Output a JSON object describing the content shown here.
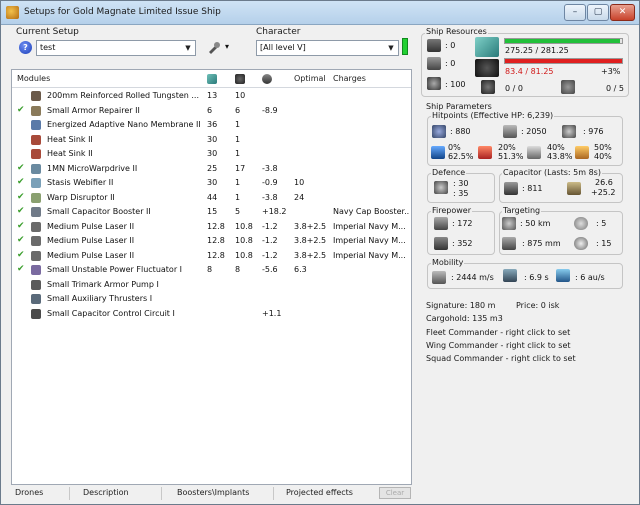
{
  "window": {
    "title": "Setups for Gold Magnate Limited Issue Ship",
    "minimize": "–",
    "maximize": "▢",
    "close": "✕"
  },
  "setup": {
    "label": "Current Setup",
    "value": "test",
    "help": "?",
    "tools_arrow": "▾"
  },
  "character": {
    "label": "Character",
    "value": "[All level V]"
  },
  "modules": {
    "headers": {
      "name": "Modules",
      "optimal": "Optimal",
      "charges": "Charges"
    },
    "rows": [
      {
        "checked": false,
        "name": "200mm Reinforced Rolled Tungsten ...",
        "cpu": "13",
        "pg": "10",
        "cap": "",
        "optimal": "",
        "charges": "",
        "icon": "#6b5a4a"
      },
      {
        "checked": true,
        "name": "Small Armor Repairer II",
        "cpu": "6",
        "pg": "6",
        "cap": "-8.9",
        "optimal": "",
        "charges": "",
        "icon": "#8a7a5a"
      },
      {
        "checked": false,
        "name": "Energized Adaptive Nano Membrane II",
        "cpu": "36",
        "pg": "1",
        "cap": "",
        "optimal": "",
        "charges": "",
        "icon": "#5a7aa8"
      },
      {
        "checked": false,
        "name": "Heat Sink II",
        "cpu": "30",
        "pg": "1",
        "cap": "",
        "optimal": "",
        "charges": "",
        "icon": "#a84a3a"
      },
      {
        "checked": false,
        "name": "Heat Sink II",
        "cpu": "30",
        "pg": "1",
        "cap": "",
        "optimal": "",
        "charges": "",
        "icon": "#a84a3a"
      },
      {
        "checked": true,
        "name": "1MN MicroWarpdrive II",
        "cpu": "25",
        "pg": "17",
        "cap": "-3.8",
        "optimal": "",
        "charges": "",
        "icon": "#6a8aa0"
      },
      {
        "checked": true,
        "name": "Stasis Webifier II",
        "cpu": "30",
        "pg": "1",
        "cap": "-0.9",
        "optimal": "10",
        "charges": "",
        "icon": "#7aa0b8"
      },
      {
        "checked": true,
        "name": "Warp Disruptor II",
        "cpu": "44",
        "pg": "1",
        "cap": "-3.8",
        "optimal": "24",
        "charges": "",
        "icon": "#8aa070"
      },
      {
        "checked": true,
        "name": "Small Capacitor Booster II",
        "cpu": "15",
        "pg": "5",
        "cap": "+18.2",
        "optimal": "",
        "charges": "Navy Cap Booster...",
        "icon": "#707a88"
      },
      {
        "checked": true,
        "name": "Medium Pulse Laser II",
        "cpu": "12.8",
        "pg": "10.8",
        "cap": "-1.2",
        "optimal": "3.8+2.5",
        "charges": "Imperial Navy M...",
        "icon": "#6a6a6a"
      },
      {
        "checked": true,
        "name": "Medium Pulse Laser II",
        "cpu": "12.8",
        "pg": "10.8",
        "cap": "-1.2",
        "optimal": "3.8+2.5",
        "charges": "Imperial Navy M...",
        "icon": "#6a6a6a"
      },
      {
        "checked": true,
        "name": "Medium Pulse Laser II",
        "cpu": "12.8",
        "pg": "10.8",
        "cap": "-1.2",
        "optimal": "3.8+2.5",
        "charges": "Imperial Navy M...",
        "icon": "#6a6a6a"
      },
      {
        "checked": true,
        "name": "Small Unstable Power Fluctuator I",
        "cpu": "8",
        "pg": "8",
        "cap": "-5.6",
        "optimal": "6.3",
        "charges": "",
        "icon": "#7a6aa0"
      },
      {
        "checked": false,
        "name": "Small Trimark Armor Pump I",
        "cpu": "",
        "pg": "",
        "cap": "",
        "optimal": "",
        "charges": "",
        "icon": "#5a5a5a"
      },
      {
        "checked": false,
        "name": "Small Auxiliary Thrusters I",
        "cpu": "",
        "pg": "",
        "cap": "",
        "optimal": "",
        "charges": "",
        "icon": "#5a6a7a"
      },
      {
        "checked": false,
        "name": "Small Capacitor Control Circuit I",
        "cpu": "",
        "pg": "",
        "cap": "+1.1",
        "optimal": "",
        "charges": "",
        "icon": "#4a4a4a"
      }
    ]
  },
  "tabs": {
    "drones": "Drones",
    "description": "Description",
    "boosters": "Boosters\\Implants",
    "projected": "Projected effects",
    "clear": "Clear"
  },
  "resources": {
    "title": "Ship Resources",
    "turrets": ": 0",
    "launchers": ": 0",
    "calibration": ": 100",
    "cpu_text": "275.25 / 281.25",
    "cpu_fraction": 0.979,
    "pg_text": "83.4 / 81.25",
    "pg_delta": "+3%",
    "pg_fraction": 1.0,
    "drone_bw": "0 / 0",
    "drone_slots": "0 / 5",
    "bar_green": "#22c03a",
    "bar_red": "#e02020"
  },
  "params": {
    "title": "Ship Parameters",
    "hitpoints_title": "Hitpoints (Effective HP: 6,239)",
    "shield_hp": ": 880",
    "armor_hp": ": 2050",
    "hull_hp": ": 976",
    "res_em": "0%\n62.5%",
    "res_therm": "20%\n51.3%",
    "res_kin": "40%\n43.8%",
    "res_exp": "50%\n40%",
    "defence_title": "Defence",
    "defence_a": ": 30",
    "defence_b": ": 35",
    "capacitor_title": "Capacitor (Lasts: 5m 8s)",
    "capacitor_val": ": 811",
    "cap_rate_a": "26.6",
    "cap_rate_b": "+25.2",
    "firepower_title": "Firepower",
    "fp_a": ": 172",
    "fp_b": ": 352",
    "targeting_title": "Targeting",
    "tgt_range": ": 50 km",
    "tgt_targets": ": 5",
    "tgt_res": ": 875 mm",
    "tgt_scan": ": 15",
    "mobility_title": "Mobility",
    "mob_speed": ": 2444 m/s",
    "mob_align": ": 6.9 s",
    "mob_warp": ": 6 au/s"
  },
  "info": {
    "signature": "Signature: 180 m",
    "price": "Price: 0 isk",
    "cargohold": "Cargohold: 135 m3",
    "fleet": "Fleet Commander - right click to set",
    "wing": "Wing Commander - right click to set",
    "squad": "Squad Commander - right click to set"
  }
}
